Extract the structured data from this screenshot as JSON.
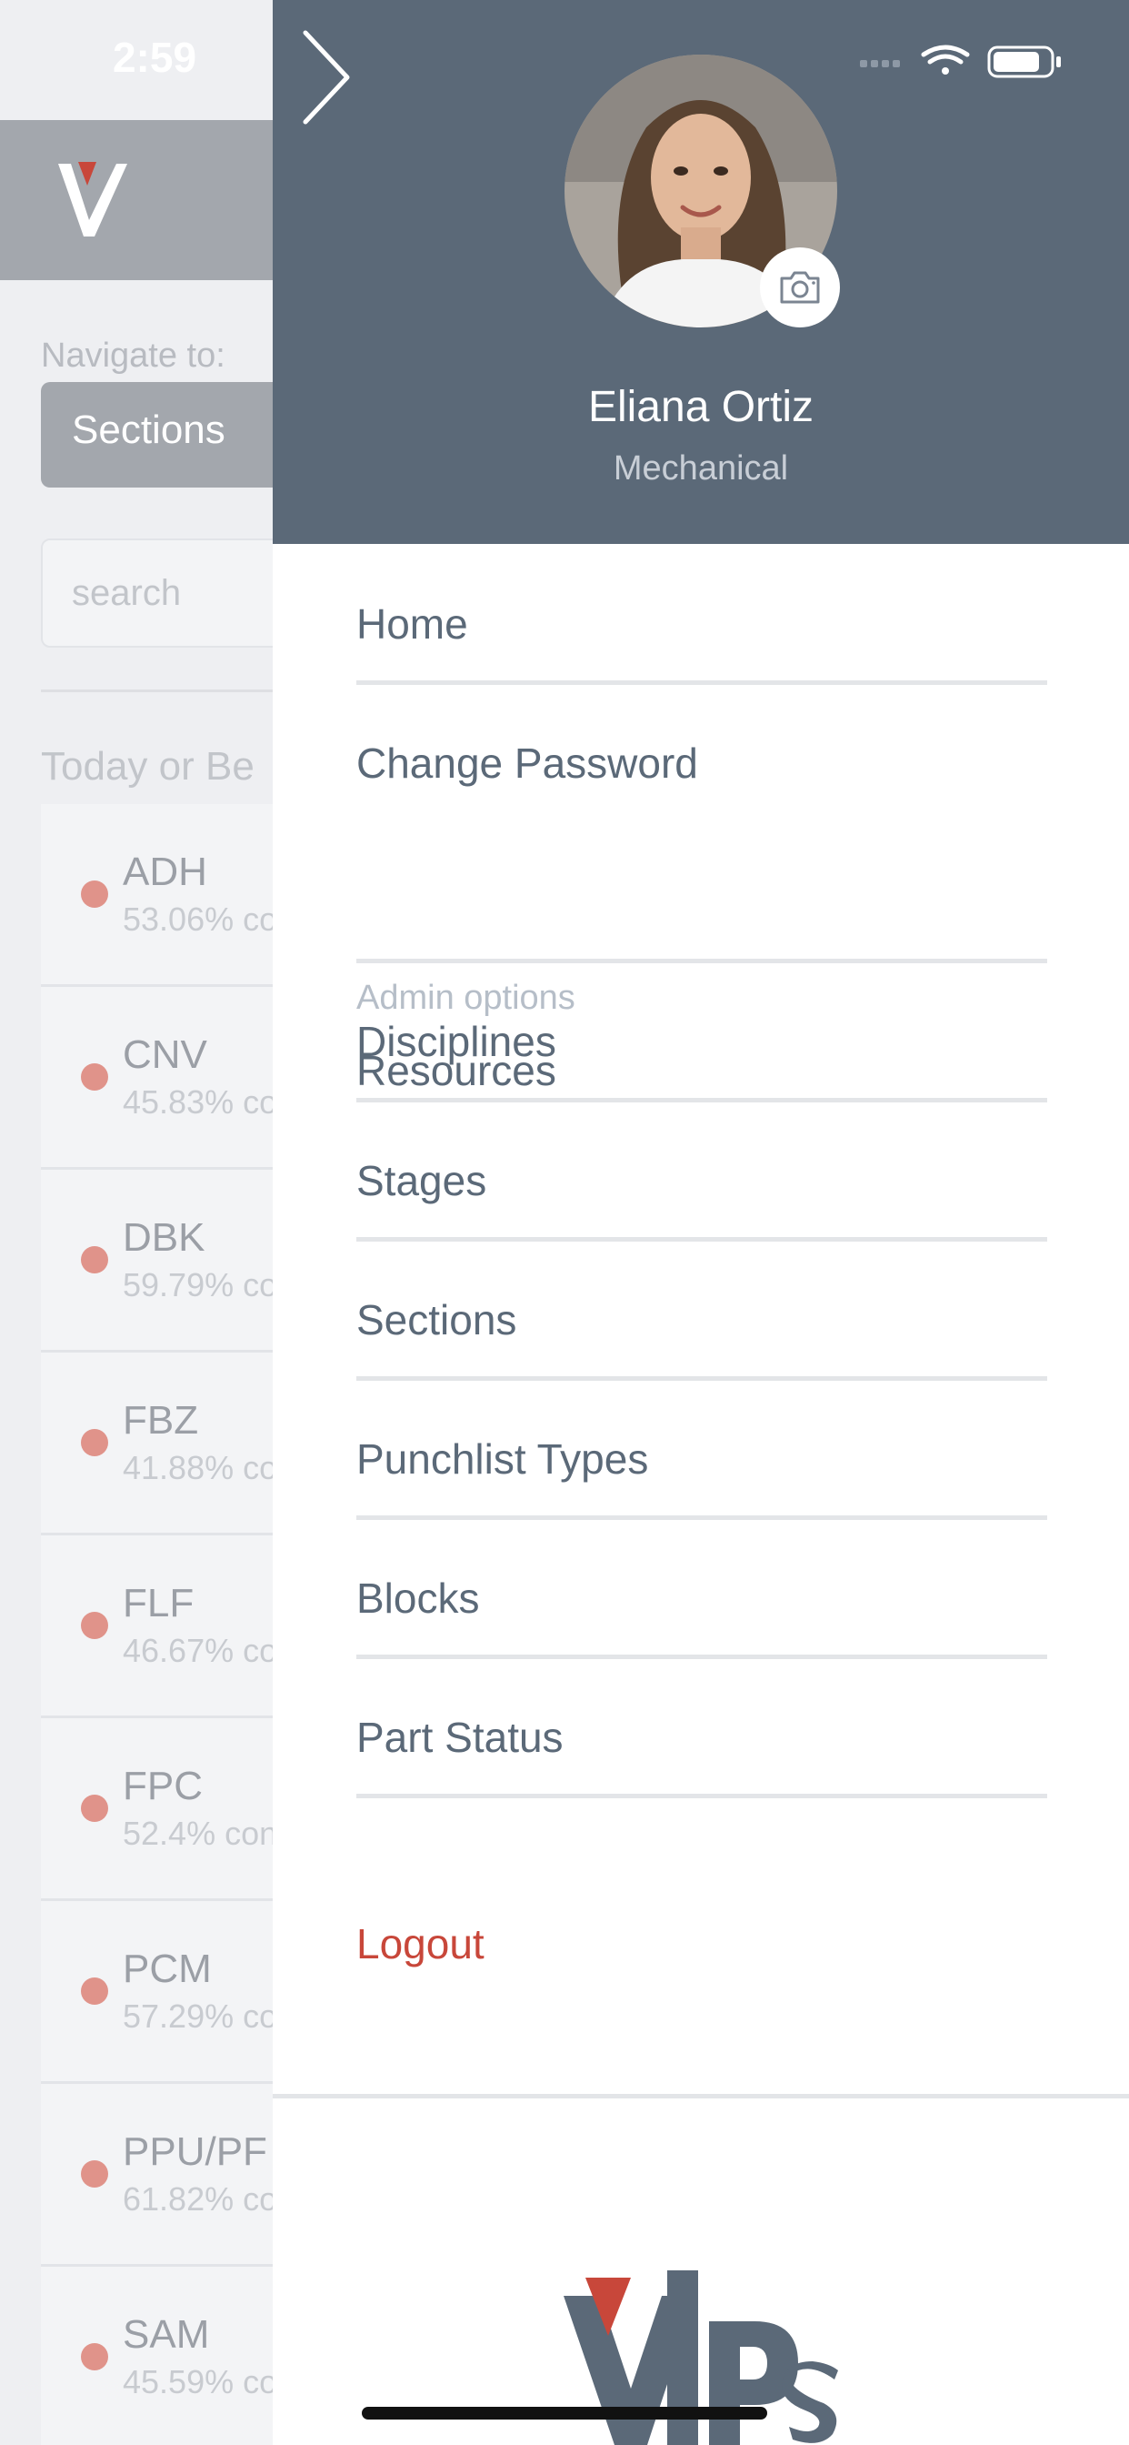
{
  "status_bar": {
    "time": "2:59"
  },
  "background": {
    "navigate_label": "Navigate to:",
    "navigate_value": "Sections",
    "search_placeholder": "search",
    "section_header": "Today or Be",
    "items": [
      {
        "code": "ADH",
        "pct": "53.06% co"
      },
      {
        "code": "CNV",
        "pct": "45.83% co"
      },
      {
        "code": "DBK",
        "pct": "59.79% co"
      },
      {
        "code": "FBZ",
        "pct": "41.88% co"
      },
      {
        "code": "FLF",
        "pct": "46.67% co"
      },
      {
        "code": "FPC",
        "pct": "52.4% con"
      },
      {
        "code": "PCM",
        "pct": "57.29% co"
      },
      {
        "code": "PPU/PF",
        "pct": "61.82% co"
      },
      {
        "code": "SAM",
        "pct": "45.59% co"
      }
    ]
  },
  "drawer": {
    "user": {
      "name": "Eliana Ortiz",
      "role": "Mechanical"
    },
    "menu": {
      "home": "Home",
      "change_password": "Change Password",
      "admin_label": "Admin options",
      "resources": "Resources",
      "disciplines": "Disciplines",
      "stages": "Stages",
      "sections": "Sections",
      "punchlist_types": "Punchlist Types",
      "blocks": "Blocks",
      "part_status": "Part Status"
    },
    "logout": "Logout"
  },
  "colors": {
    "header_bg": "#5b6978",
    "menu_text": "#5b6978",
    "logout": "#c8473a",
    "status_dot": "#e0938a",
    "brand_red": "#c8473a",
    "brand_slate": "#5b6978"
  },
  "icons": [
    "chevron-right-icon",
    "signal-icon",
    "wifi-icon",
    "battery-icon",
    "camera-icon",
    "brand-logo"
  ]
}
